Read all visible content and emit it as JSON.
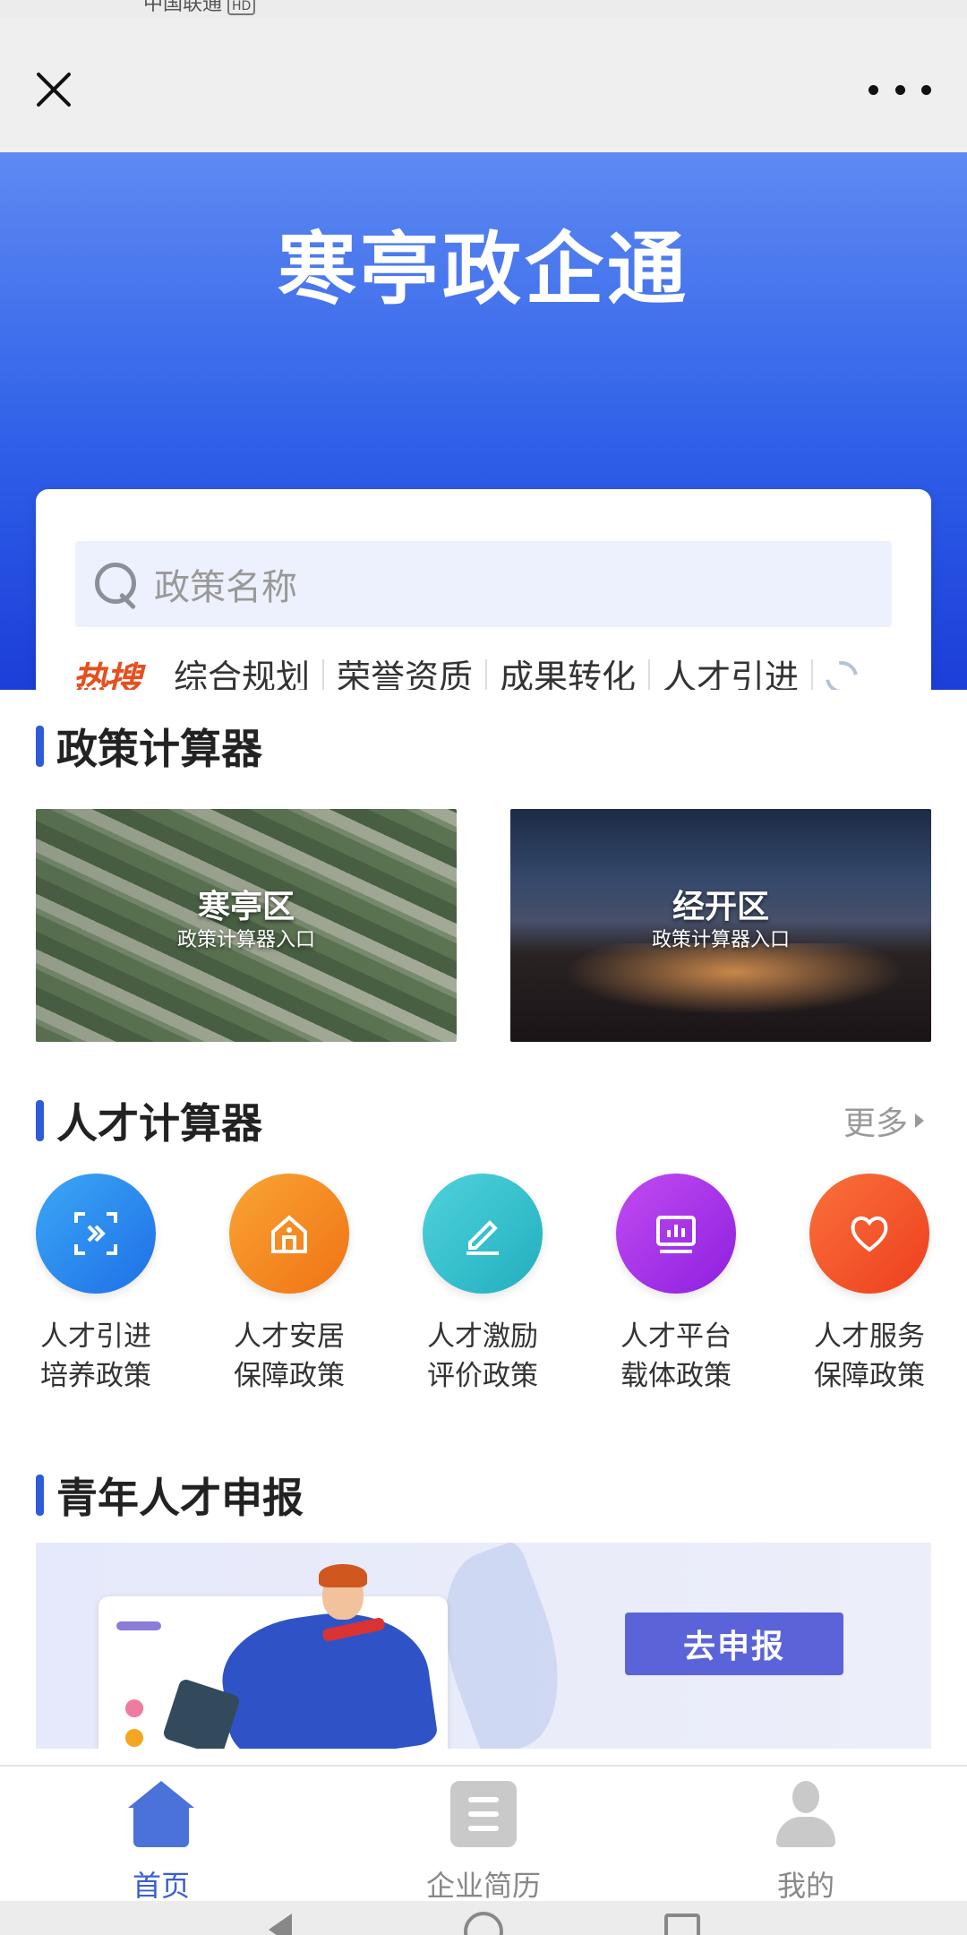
{
  "status_bar": {
    "carrier": "中国联通",
    "hd_badge": "HD"
  },
  "hero": {
    "title": "寒亭政企通"
  },
  "search": {
    "placeholder": "政策名称",
    "hot_label": "热搜",
    "hot_tags": [
      "综合规划",
      "荣誉资质",
      "成果转化",
      "人才引进"
    ]
  },
  "policy_calculator": {
    "title": "政策计算器",
    "cards": [
      {
        "name": "寒亭区",
        "subtitle": "政策计算器入口"
      },
      {
        "name": "经开区",
        "subtitle": "政策计算器入口"
      }
    ]
  },
  "talent_calculator": {
    "title": "人才计算器",
    "more": "更多",
    "items": [
      {
        "line1": "人才引进",
        "line2": "培养政策",
        "icon": "scan-icon",
        "color": "#2f8ef0"
      },
      {
        "line1": "人才安居",
        "line2": "保障政策",
        "icon": "house-icon",
        "color": "#f58a1f"
      },
      {
        "line1": "人才激励",
        "line2": "评价政策",
        "icon": "pen-icon",
        "color": "#2ec0cf"
      },
      {
        "line1": "人才平台",
        "line2": "载体政策",
        "icon": "chart-icon",
        "color": "#a72ee8"
      },
      {
        "line1": "人才服务",
        "line2": "保障政策",
        "icon": "heart-icon",
        "color": "#f4582a"
      }
    ]
  },
  "youth_apply": {
    "title": "青年人才申报",
    "button": "去申报"
  },
  "tabbar": {
    "items": [
      {
        "label": "首页",
        "icon": "home-icon",
        "active": true
      },
      {
        "label": "企业简历",
        "icon": "document-icon",
        "active": false
      },
      {
        "label": "我的",
        "icon": "profile-icon",
        "active": false
      }
    ]
  },
  "colors": {
    "brand_blue": "#2f5fe8",
    "hot_orange": "#e5501e",
    "apply_button": "#5b63d8"
  }
}
